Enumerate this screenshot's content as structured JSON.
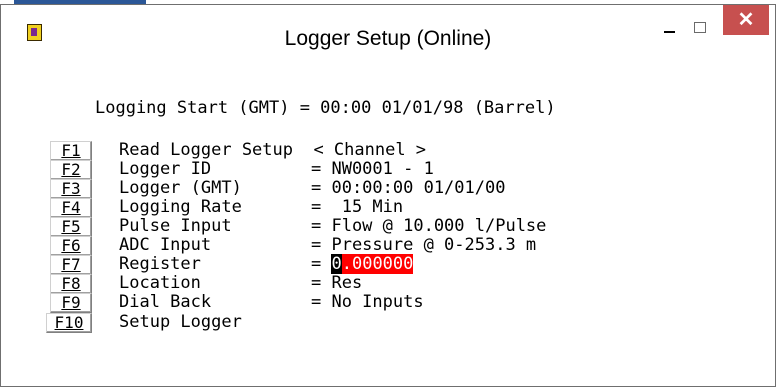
{
  "window": {
    "title": "Logger Setup (Online)",
    "close_symbol": "✕"
  },
  "header": {
    "logging_start": "Logging Start (GMT) = 00:00 01/01/98 (Barrel)"
  },
  "rows": [
    {
      "key": "F1",
      "label": "Read Logger Setup  < Channel >",
      "value": ""
    },
    {
      "key": "F2",
      "label": "Logger ID",
      "value": "= NW0001 - 1"
    },
    {
      "key": "F3",
      "label": "Logger (GMT)",
      "value": "= 00:00:00 01/01/00"
    },
    {
      "key": "F4",
      "label": "Logging Rate",
      "value": "=  15 Min"
    },
    {
      "key": "F5",
      "label": "Pulse Input",
      "value": "= Flow @ 10.000 l/Pulse"
    },
    {
      "key": "F6",
      "label": "ADC Input",
      "value": "= Pressure @ 0-253.3 m"
    },
    {
      "key": "F7",
      "label": "Register",
      "value": "= "
    },
    {
      "key": "F8",
      "label": "Location",
      "value": "= Res"
    },
    {
      "key": "F9",
      "label": "Dial Back",
      "value": "= No Inputs"
    },
    {
      "key": "F10",
      "label": "Setup Logger",
      "value": ""
    }
  ],
  "register_field": {
    "cursor_char": "0",
    "selected_text": ".000000"
  },
  "colors": {
    "close_button": "#c7504f",
    "selection": "#ff0000",
    "cursor": "#000000"
  },
  "icons": {
    "app": "logger-app-icon",
    "minimize": "minimize-icon",
    "maximize": "maximize-icon",
    "close": "close-icon"
  }
}
